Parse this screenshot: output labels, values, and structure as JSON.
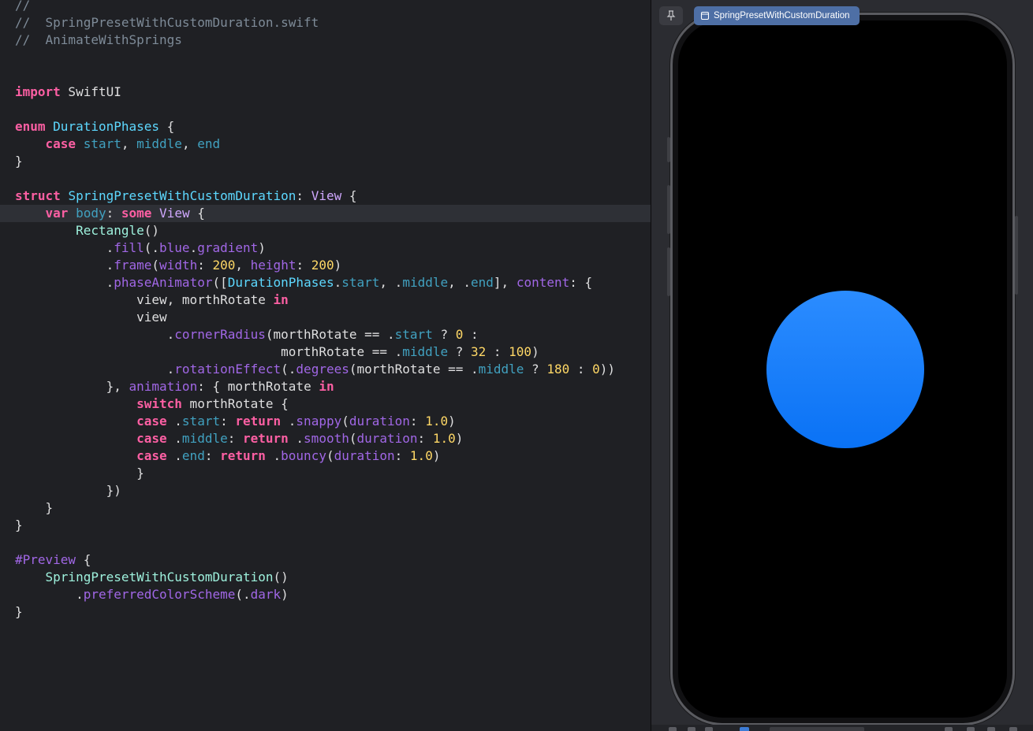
{
  "editor": {
    "code_lines": [
      [
        {
          "t": "//",
          "c": "comment"
        }
      ],
      [
        {
          "t": "//  SpringPresetWithCustomDuration.swift",
          "c": "comment"
        }
      ],
      [
        {
          "t": "//  AnimateWithSprings",
          "c": "comment"
        }
      ],
      [],
      [],
      [
        {
          "t": "import",
          "c": "keyword"
        },
        {
          "t": " SwiftUI",
          "c": "plain"
        }
      ],
      [],
      [
        {
          "t": "enum",
          "c": "keyword"
        },
        {
          "t": " ",
          "c": "plain"
        },
        {
          "t": "DurationPhases",
          "c": "type"
        },
        {
          "t": " {",
          "c": "plain"
        }
      ],
      [
        {
          "t": "    ",
          "c": "plain"
        },
        {
          "t": "case",
          "c": "keyword"
        },
        {
          "t": " ",
          "c": "plain"
        },
        {
          "t": "start",
          "c": "decl"
        },
        {
          "t": ", ",
          "c": "plain"
        },
        {
          "t": "middle",
          "c": "decl"
        },
        {
          "t": ", ",
          "c": "plain"
        },
        {
          "t": "end",
          "c": "decl"
        }
      ],
      [
        {
          "t": "}",
          "c": "plain"
        }
      ],
      [],
      [
        {
          "t": "struct",
          "c": "keyword"
        },
        {
          "t": " ",
          "c": "plain"
        },
        {
          "t": "SpringPresetWithCustomDuration",
          "c": "type"
        },
        {
          "t": ": ",
          "c": "plain"
        },
        {
          "t": "View",
          "c": "sysfunc"
        },
        {
          "t": " {",
          "c": "plain"
        }
      ],
      [
        {
          "t": "    ",
          "c": "plain"
        },
        {
          "t": "var",
          "c": "keyword"
        },
        {
          "t": " ",
          "c": "plain"
        },
        {
          "t": "body",
          "c": "decl"
        },
        {
          "t": ": ",
          "c": "plain"
        },
        {
          "t": "some",
          "c": "keyword"
        },
        {
          "t": " ",
          "c": "plain"
        },
        {
          "t": "View",
          "c": "sysfunc"
        },
        {
          "t": " {",
          "c": "plain"
        }
      ],
      [
        {
          "t": "        ",
          "c": "plain"
        },
        {
          "t": "Rectangle",
          "c": "projtype"
        },
        {
          "t": "()",
          "c": "plain"
        }
      ],
      [
        {
          "t": "            .",
          "c": "plain"
        },
        {
          "t": "fill",
          "c": "func"
        },
        {
          "t": "(.",
          "c": "plain"
        },
        {
          "t": "blue",
          "c": "func"
        },
        {
          "t": ".",
          "c": "plain"
        },
        {
          "t": "gradient",
          "c": "func"
        },
        {
          "t": ")",
          "c": "plain"
        }
      ],
      [
        {
          "t": "            .",
          "c": "plain"
        },
        {
          "t": "frame",
          "c": "func"
        },
        {
          "t": "(",
          "c": "plain"
        },
        {
          "t": "width",
          "c": "func"
        },
        {
          "t": ": ",
          "c": "plain"
        },
        {
          "t": "200",
          "c": "number"
        },
        {
          "t": ", ",
          "c": "plain"
        },
        {
          "t": "height",
          "c": "func"
        },
        {
          "t": ": ",
          "c": "plain"
        },
        {
          "t": "200",
          "c": "number"
        },
        {
          "t": ")",
          "c": "plain"
        }
      ],
      [
        {
          "t": "            .",
          "c": "plain"
        },
        {
          "t": "phaseAnimator",
          "c": "func"
        },
        {
          "t": "([",
          "c": "plain"
        },
        {
          "t": "DurationPhases",
          "c": "type"
        },
        {
          "t": ".",
          "c": "plain"
        },
        {
          "t": "start",
          "c": "decl"
        },
        {
          "t": ", .",
          "c": "plain"
        },
        {
          "t": "middle",
          "c": "decl"
        },
        {
          "t": ", .",
          "c": "plain"
        },
        {
          "t": "end",
          "c": "decl"
        },
        {
          "t": "], ",
          "c": "plain"
        },
        {
          "t": "content",
          "c": "func"
        },
        {
          "t": ": {",
          "c": "plain"
        }
      ],
      [
        {
          "t": "                view, morthRotate ",
          "c": "plain"
        },
        {
          "t": "in",
          "c": "keyword"
        }
      ],
      [
        {
          "t": "                view",
          "c": "plain"
        }
      ],
      [
        {
          "t": "                    .",
          "c": "plain"
        },
        {
          "t": "cornerRadius",
          "c": "func"
        },
        {
          "t": "(morthRotate == .",
          "c": "plain"
        },
        {
          "t": "start",
          "c": "decl"
        },
        {
          "t": " ? ",
          "c": "plain"
        },
        {
          "t": "0",
          "c": "number"
        },
        {
          "t": " :",
          "c": "plain"
        }
      ],
      [
        {
          "t": "                                   morthRotate == .",
          "c": "plain"
        },
        {
          "t": "middle",
          "c": "decl"
        },
        {
          "t": " ? ",
          "c": "plain"
        },
        {
          "t": "32",
          "c": "number"
        },
        {
          "t": " : ",
          "c": "plain"
        },
        {
          "t": "100",
          "c": "number"
        },
        {
          "t": ")",
          "c": "plain"
        }
      ],
      [
        {
          "t": "                    .",
          "c": "plain"
        },
        {
          "t": "rotationEffect",
          "c": "func"
        },
        {
          "t": "(.",
          "c": "plain"
        },
        {
          "t": "degrees",
          "c": "func"
        },
        {
          "t": "(morthRotate == .",
          "c": "plain"
        },
        {
          "t": "middle",
          "c": "decl"
        },
        {
          "t": " ? ",
          "c": "plain"
        },
        {
          "t": "180",
          "c": "number"
        },
        {
          "t": " : ",
          "c": "plain"
        },
        {
          "t": "0",
          "c": "number"
        },
        {
          "t": "))",
          "c": "plain"
        }
      ],
      [
        {
          "t": "            }, ",
          "c": "plain"
        },
        {
          "t": "animation",
          "c": "func"
        },
        {
          "t": ": { morthRotate ",
          "c": "plain"
        },
        {
          "t": "in",
          "c": "keyword"
        }
      ],
      [
        {
          "t": "                ",
          "c": "plain"
        },
        {
          "t": "switch",
          "c": "keyword"
        },
        {
          "t": " morthRotate {",
          "c": "plain"
        }
      ],
      [
        {
          "t": "                ",
          "c": "plain"
        },
        {
          "t": "case",
          "c": "keyword"
        },
        {
          "t": " .",
          "c": "plain"
        },
        {
          "t": "start",
          "c": "decl"
        },
        {
          "t": ": ",
          "c": "plain"
        },
        {
          "t": "return",
          "c": "keyword"
        },
        {
          "t": " .",
          "c": "plain"
        },
        {
          "t": "snappy",
          "c": "func"
        },
        {
          "t": "(",
          "c": "plain"
        },
        {
          "t": "duration",
          "c": "func"
        },
        {
          "t": ": ",
          "c": "plain"
        },
        {
          "t": "1.0",
          "c": "number"
        },
        {
          "t": ")",
          "c": "plain"
        }
      ],
      [
        {
          "t": "                ",
          "c": "plain"
        },
        {
          "t": "case",
          "c": "keyword"
        },
        {
          "t": " .",
          "c": "plain"
        },
        {
          "t": "middle",
          "c": "decl"
        },
        {
          "t": ": ",
          "c": "plain"
        },
        {
          "t": "return",
          "c": "keyword"
        },
        {
          "t": " .",
          "c": "plain"
        },
        {
          "t": "smooth",
          "c": "func"
        },
        {
          "t": "(",
          "c": "plain"
        },
        {
          "t": "duration",
          "c": "func"
        },
        {
          "t": ": ",
          "c": "plain"
        },
        {
          "t": "1.0",
          "c": "number"
        },
        {
          "t": ")",
          "c": "plain"
        }
      ],
      [
        {
          "t": "                ",
          "c": "plain"
        },
        {
          "t": "case",
          "c": "keyword"
        },
        {
          "t": " .",
          "c": "plain"
        },
        {
          "t": "end",
          "c": "decl"
        },
        {
          "t": ": ",
          "c": "plain"
        },
        {
          "t": "return",
          "c": "keyword"
        },
        {
          "t": " .",
          "c": "plain"
        },
        {
          "t": "bouncy",
          "c": "func"
        },
        {
          "t": "(",
          "c": "plain"
        },
        {
          "t": "duration",
          "c": "func"
        },
        {
          "t": ": ",
          "c": "plain"
        },
        {
          "t": "1.0",
          "c": "number"
        },
        {
          "t": ")",
          "c": "plain"
        }
      ],
      [
        {
          "t": "                }",
          "c": "plain"
        }
      ],
      [
        {
          "t": "            })",
          "c": "plain"
        }
      ],
      [
        {
          "t": "    }",
          "c": "plain"
        }
      ],
      [
        {
          "t": "}",
          "c": "plain"
        }
      ],
      [],
      [
        {
          "t": "#Preview",
          "c": "preproc"
        },
        {
          "t": " {",
          "c": "plain"
        }
      ],
      [
        {
          "t": "    ",
          "c": "plain"
        },
        {
          "t": "SpringPresetWithCustomDuration",
          "c": "projtype"
        },
        {
          "t": "()",
          "c": "plain"
        }
      ],
      [
        {
          "t": "        .",
          "c": "plain"
        },
        {
          "t": "preferredColorScheme",
          "c": "func"
        },
        {
          "t": "(.",
          "c": "plain"
        },
        {
          "t": "dark",
          "c": "func"
        },
        {
          "t": ")",
          "c": "plain"
        }
      ],
      [
        {
          "t": "}",
          "c": "plain"
        }
      ]
    ],
    "current_line_index": 12
  },
  "canvas": {
    "preview_title": "SpringPresetWithCustomDuration",
    "pin_icon": "pin-icon",
    "preview_icon": "device-icon",
    "shape_colors": [
      "#2b8cff",
      "#0a72f5"
    ]
  }
}
